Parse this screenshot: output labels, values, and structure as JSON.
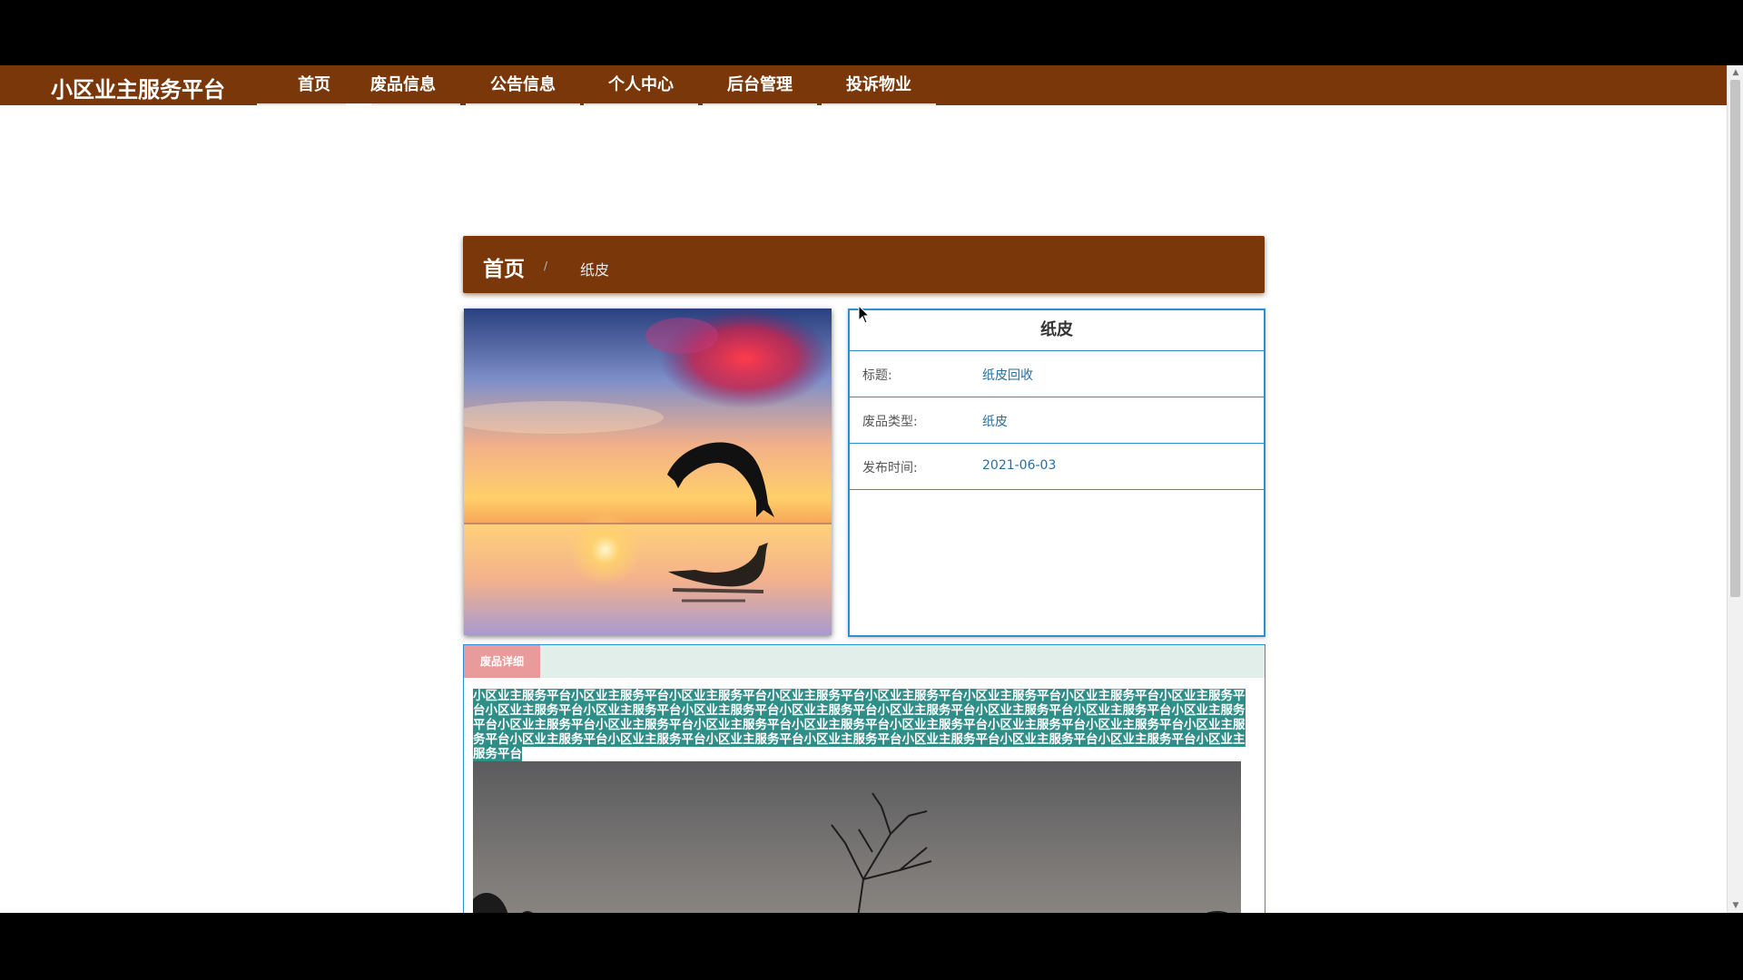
{
  "navbar": {
    "site_title": "小区业主服务平台",
    "items": [
      {
        "label": "首页"
      },
      {
        "label": "废品信息"
      },
      {
        "label": "公告信息"
      },
      {
        "label": "个人中心"
      },
      {
        "label": "后台管理"
      },
      {
        "label": "投诉物业"
      }
    ],
    "bg_color": "#7a380a"
  },
  "breadcrumb": {
    "home": "首页",
    "separator": "/",
    "current": "纸皮"
  },
  "product_image": {
    "icon": "dolphin-sunset-image"
  },
  "info_card": {
    "title": "纸皮",
    "rows": [
      {
        "label": "标题:",
        "value": "纸皮回收"
      },
      {
        "label": "废品类型:",
        "value": "纸皮"
      },
      {
        "label": "发布时间:",
        "value": "2021-06-03"
      }
    ],
    "border_color": "#2c8fd0"
  },
  "detail": {
    "tab_label": "废品详细",
    "text": "小区业主服务平台小区业主服务平台小区业主服务平台小区业主服务平台小区业主服务平台小区业主服务平台小区业主服务平台小区业主服务平台小区业主服务平台小区业主服务平台小区业主服务平台小区业主服务平台小区业主服务平台小区业主服务平台小区业主服务平台小区业主服务平台小区业主服务平台小区业主服务平台小区业主服务平台小区业主服务平台小区业主服务平台小区业主服务平台小区业主服务平台小区业主服务平台小区业主服务平台小区业主服务平台小区业主服务平台小区业主服务平台小区业主服务平台小区业主服务平台小区业主服务平台小区业主服务平台",
    "photo_icon": "dusk-tree-photo"
  }
}
